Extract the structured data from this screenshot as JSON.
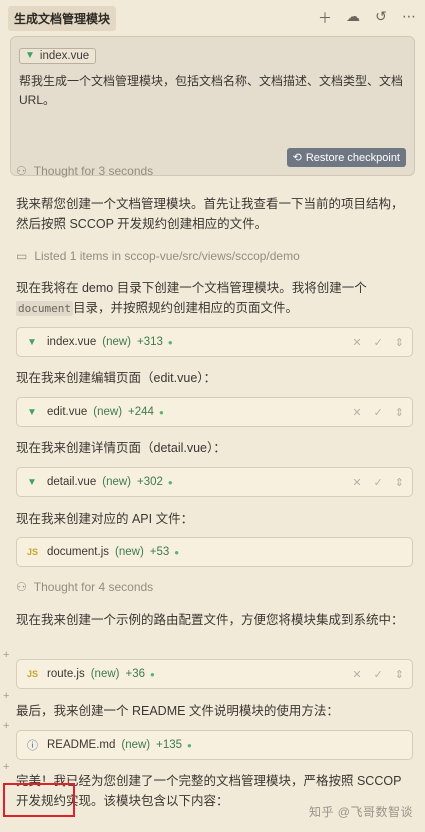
{
  "header": {
    "title": "生成文档管理模块",
    "icons": [
      "plus-icon",
      "cloud-icon",
      "history-icon",
      "more-icon"
    ]
  },
  "prompt": {
    "file_tag": "index.vue",
    "text": "帮我生成一个文档管理模块，包括文档名称、文档描述、文档类型、文档URL。",
    "restore_label": "Restore checkpoint"
  },
  "thought1": "Thought for 3 seconds",
  "msg1": "我来帮您创建一个文档管理模块。首先让我查看一下当前的项目结构，然后按照 SCCOP 开发规约创建相应的文件。",
  "listed": "Listed 1 items in sccop-vue/src/views/sccop/demo",
  "msg2_a": "现在我将在 demo 目录下创建一个文档管理模块。我将创建一个",
  "msg2_code": "document",
  "msg2_b": "目录，并按照规约创建相应的页面文件。",
  "files": [
    {
      "name": "index.vue",
      "tag": "(new)",
      "delta": "+313"
    },
    {
      "name": "edit.vue",
      "tag": "(new)",
      "delta": "+244"
    },
    {
      "name": "detail.vue",
      "tag": "(new)",
      "delta": "+302"
    },
    {
      "name": "document.js",
      "tag": "(new)",
      "delta": "+53"
    },
    {
      "name": "route.js",
      "tag": "(new)",
      "delta": "+36"
    },
    {
      "name": "README.md",
      "tag": "(new)",
      "delta": "+135"
    }
  ],
  "msg3": "现在我来创建编辑页面（edit.vue）：",
  "msg4": "现在我来创建详情页面（detail.vue）：",
  "msg5": "现在我来创建对应的 API 文件：",
  "thought2": "Thought for 4 seconds",
  "msg6": "现在我来创建一个示例的路由配置文件，方便您将模块集成到系统中：",
  "msg7": "最后，我来创建一个 README 文件说明模块的使用方法：",
  "msg8": "完美！我已经为您创建了一个完整的文档管理模块，严格按照 SCCOP 开发规约实现。该模块包含以下内容：",
  "watermark": "知乎 @飞哥数智谈",
  "colors": {
    "background": "#f2ead9",
    "vue_green": "#41a35e",
    "accent_green": "#3d7a4f",
    "highlight_red": "#e0202a"
  }
}
